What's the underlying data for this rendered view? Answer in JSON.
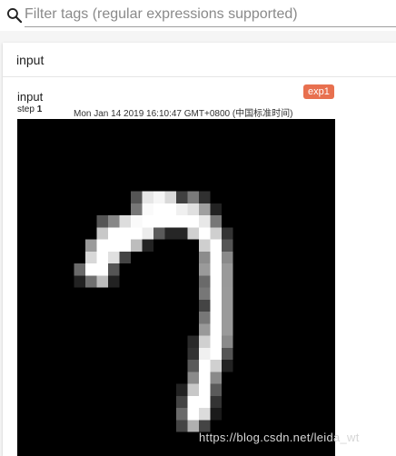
{
  "filter": {
    "placeholder": "Filter tags (regular expressions supported)",
    "value": ""
  },
  "section": {
    "title": "input"
  },
  "card": {
    "tag": "input",
    "run": "exp1",
    "run_color": "#e8704f",
    "step_label": "step",
    "step_value": "1",
    "timestamp": "Mon Jan 14 2019 16:10:47 GMT+0800 (中国标准时间)",
    "image_description": "28x28 grayscale MNIST digit 7"
  },
  "watermark": "https://blog.csdn.net/leida_wt",
  "icons": {
    "search": "search-icon"
  }
}
